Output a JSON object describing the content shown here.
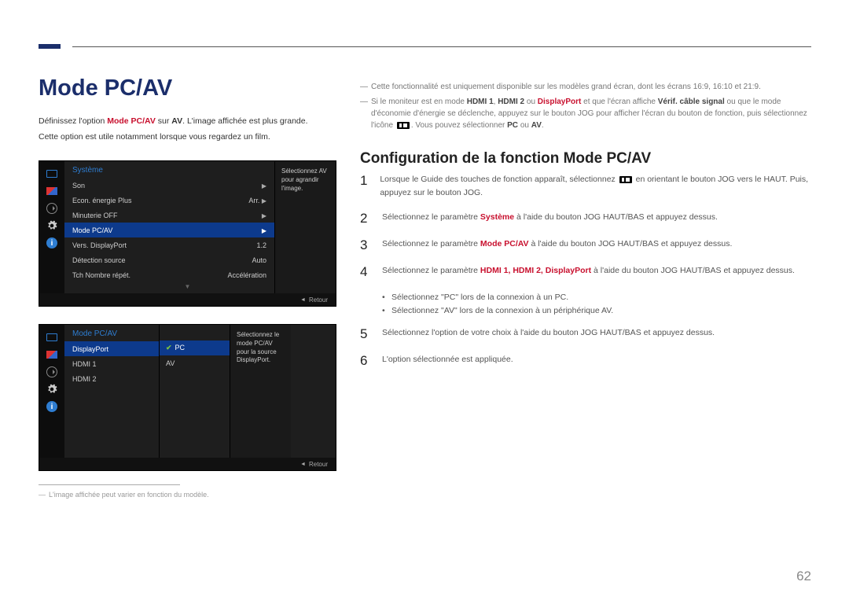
{
  "page_title": "Mode PC/AV",
  "intro": {
    "line1_a": "Définissez l'option ",
    "line1_red": "Mode PC/AV",
    "line1_b": " sur ",
    "line1_bold": "AV",
    "line1_c": ". L'image affichée est plus grande.",
    "line2": "Cette option est utile notamment lorsque vous regardez un film."
  },
  "right_notes": {
    "n1": "Cette fonctionnalité est uniquement disponible sur les modèles grand écran, dont les écrans 16:9, 16:10 et 21:9.",
    "n2_a": "Si le moniteur est en mode ",
    "n2_h1": "HDMI 1",
    "n2_c1": ", ",
    "n2_h2": "HDMI 2",
    "n2_c2": " ou ",
    "n2_dp": "DisplayPort",
    "n2_b": " et que l'écran affiche ",
    "n2_ver": "Vérif. câble signal",
    "n2_c": " ou que le mode d'économie d'énergie se déclenche, appuyez sur le bouton JOG pour afficher l'écran du bouton de fonction, puis sélectionnez l'icône ",
    "n2_d": ". Vous pouvez sélectionner ",
    "n2_pc": "PC",
    "n2_or": " ou ",
    "n2_av": "AV",
    "n2_e": "."
  },
  "config_title": "Configuration de la fonction Mode PC/AV",
  "steps": {
    "s1_a": "Lorsque le Guide des touches de fonction apparaît, sélectionnez ",
    "s1_b": " en orientant le bouton JOG vers le HAUT. Puis, appuyez sur le bouton JOG.",
    "s2_a": "Sélectionnez le paramètre ",
    "s2_red": "Système",
    "s2_b": " à l'aide du bouton JOG HAUT/BAS et appuyez dessus.",
    "s3_a": "Sélectionnez le paramètre ",
    "s3_red": "Mode PC/AV",
    "s3_b": " à l'aide du bouton JOG HAUT/BAS et appuyez dessus.",
    "s4_a": "Sélectionnez le paramètre ",
    "s4_red": "HDMI 1, HDMI 2, DisplayPort",
    "s4_b": " à l'aide du bouton JOG HAUT/BAS et appuyez dessus.",
    "b1": "Sélectionnez \"PC\" lors de la connexion à un PC.",
    "b2": "Sélectionnez \"AV\" lors de la connexion à un périphérique AV.",
    "s5": "Sélectionnez l'option de votre choix à l'aide du bouton JOG HAUT/BAS et appuyez dessus.",
    "s6": "L'option sélectionnée est appliquée."
  },
  "osd1": {
    "header": "Système",
    "rows": [
      {
        "label": "Son",
        "value": "",
        "chev": true
      },
      {
        "label": "Econ. énergie Plus",
        "value": "Arr.",
        "chev": true
      },
      {
        "label": "Minuterie OFF",
        "value": "",
        "chev": true
      },
      {
        "label": "Mode PC/AV",
        "value": "",
        "chev": true,
        "sel": true
      },
      {
        "label": "Vers. DisplayPort",
        "value": "1.2",
        "chev": false
      },
      {
        "label": "Détection source",
        "value": "Auto",
        "chev": false
      },
      {
        "label": "Tch Nombre répét.",
        "value": "Accélération",
        "chev": false
      }
    ],
    "desc": "Sélectionnez AV pour agrandir l'image.",
    "retour": "Retour"
  },
  "osd2": {
    "header": "Mode PC/AV",
    "rows": [
      {
        "label": "DisplayPort",
        "sel": true
      },
      {
        "label": "HDMI 1"
      },
      {
        "label": "HDMI 2"
      }
    ],
    "sub": [
      {
        "label": "PC",
        "sel": true,
        "check": true
      },
      {
        "label": "AV"
      }
    ],
    "desc": "Sélectionnez le mode PC/AV pour la source DisplayPort.",
    "retour": "Retour"
  },
  "footnote": "L'image affichée peut varier en fonction du modèle.",
  "page_number": "62"
}
